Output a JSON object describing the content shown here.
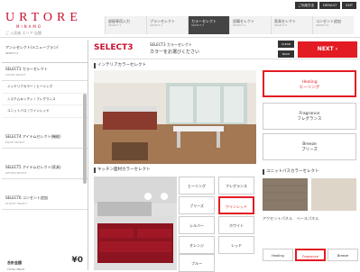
{
  "header": {
    "brand": "URTORE",
    "brand_sub": "MINAMO",
    "tagline": "ご 入居者 エリア 店舗",
    "top_links": [
      "ご利用方法",
      "DEFAULT",
      "EXIT"
    ],
    "steps": [
      {
        "label": "部屋専用入力",
        "sub": "SELECT 1"
      },
      {
        "label": "プランセレクト",
        "sub": "SELECT 2"
      },
      {
        "label": "カラーセレクト",
        "sub": "SELECT 3"
      },
      {
        "label": "設備セレクト",
        "sub": "SELECT 4"
      },
      {
        "label": "家具セレクト",
        "sub": "SELECT 5"
      },
      {
        "label": "コンセント追加",
        "sub": "SELECT 6"
      },
      {
        "label": "一覧表示",
        "sub": "SELECT 7"
      }
    ]
  },
  "sidebar": {
    "top_label": "アンシセレクト/メニューブラン/",
    "top_sub": "SELECT 2",
    "section3": {
      "label": "SELECT3 カラーセレクト",
      "sub": "COLOR SELECT"
    },
    "items": [
      "インテリアカラー / ヒーリング",
      "システムキッチン / フレグランス",
      "ユニットバス / ワインレッド"
    ],
    "section4": {
      "label": "SELECT4 アイテムセレクト(機能)",
      "sub": "EQUIP SELECT"
    },
    "section5": {
      "label": "SELECT5 アイテムセレクト(家具)",
      "sub": "OPTION SELECT"
    },
    "section6": {
      "label": "SELECT6 コンセント追加",
      "sub": "OUTLET SELECT"
    },
    "price_label": "合計金額",
    "price_sub": "TOTAL PRICE",
    "price_value": "¥0"
  },
  "selbar": {
    "number": "SELECT3",
    "title": "SELECT3 カラーセレクト",
    "message": "カラーをお選びください",
    "btn_back": "BACK",
    "btn_clear": "CLEAR",
    "next": "NEXT"
  },
  "interior": {
    "title": "インテリアカラーセレクト",
    "options": [
      {
        "label": "Healing",
        "sub": "ヒーリング",
        "selected": true
      },
      {
        "label": "Fragrance",
        "sub": "フレグランス",
        "selected": false
      },
      {
        "label": "Breeze",
        "sub": "ブリーズ",
        "selected": false
      }
    ]
  },
  "kitchen": {
    "title": "キッチン面材カラーセレクト",
    "options": [
      "ヒーリング",
      "フレグランス",
      "ブリーズ",
      "ワインレッド",
      "シルバー",
      "ホワイト",
      "オレンジ",
      "レッド",
      "ブルー"
    ],
    "selected": "ワインレッド"
  },
  "bath": {
    "title": "ユニットバスカラーセレクト",
    "panel_label": "アクセントパネル　ベースパネル",
    "options": [
      "Healing",
      "Fragrance",
      "Breeze"
    ],
    "selected": "Fragrance"
  },
  "colors": {
    "accent": "#e31b23",
    "dark": "#333333"
  }
}
